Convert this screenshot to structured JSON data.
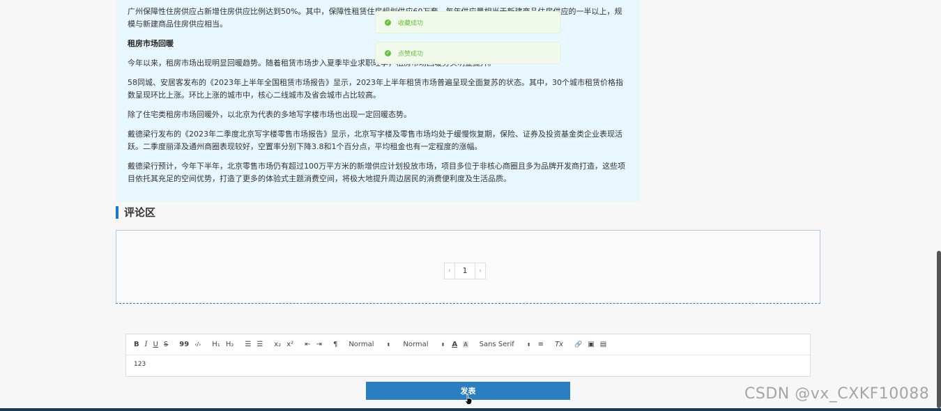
{
  "article": {
    "p1": "广州保障性住房供应占新增住房供应比例达到50%。其中，保障性租赁住房规划供应60万套，每年供应量相当于新建商品住房供应的一半以上，规模与新建商品住房供应相当。",
    "heading": "租房市场回暖",
    "p2": "今年以来，租房市场出现明显回暖趋势。随着租赁市场步入夏季毕业求职旺季，租房市场回暖势头明显提升。",
    "p3": "58同城、安居客发布的《2023年上半年全国租赁市场报告》显示，2023年上半年租赁市场普遍呈现全面复苏的状态。其中，30个城市租赁价格指数呈现环比上涨。环比上涨的城市中，核心二线城市及省会城市占比较高。",
    "p4": "除了住宅类租房市场回暖外，以北京为代表的多地写字楼市场也出现一定回暖态势。",
    "p5": "戴德梁行发布的《2023年二季度北京写字楼零售市场报告》显示，北京写字楼及零售市场均处于缓慢恢复期，保险、证券及投资基金类企业表现活跃。二季度丽泽及通州商圈表现较好，空置率分别下降3.8和1个百分点，平均租金也有一定程度的涨幅。",
    "p6": "戴德梁行预计，今年下半年，北京零售市场仍有超过100万平方米的新增供应计划投放市场，项目多位于非核心商圈且多为品牌开发商打造，这些项目依托其充足的空间优势，打造了更多的体验式主题消费空间，将极大地提升周边居民的消费便利度及生活品质。"
  },
  "toasts": {
    "collect": "收藏成功",
    "like": "点赞成功"
  },
  "comments": {
    "title": "评论区",
    "pager": {
      "prev": "‹",
      "page": "1",
      "next": "›"
    }
  },
  "editor": {
    "toolbar": {
      "bold": "B",
      "italic": "I",
      "underline": "U",
      "strike": "S",
      "quote": "99",
      "code": "‹/›",
      "h1": "H₁",
      "h2": "H₂",
      "ol": "☰",
      "ul": "☰",
      "sub": "x₂",
      "sup": "x²",
      "outdent": "⇤",
      "indent": "⇥",
      "direction": "¶",
      "size": "Normal",
      "header": "Normal",
      "color": "A",
      "background": "A",
      "font": "Sans Serif",
      "align": "≡",
      "clean": "Tx",
      "link": "🔗",
      "image": "▣",
      "video": "▤"
    },
    "content": "123"
  },
  "submit_label": "发表",
  "watermark": "CSDN @vx_CXKF10088",
  "colors": {
    "accent": "#2a7fc1",
    "card_bg": "#e8f7fd",
    "success": "#67c23a"
  }
}
